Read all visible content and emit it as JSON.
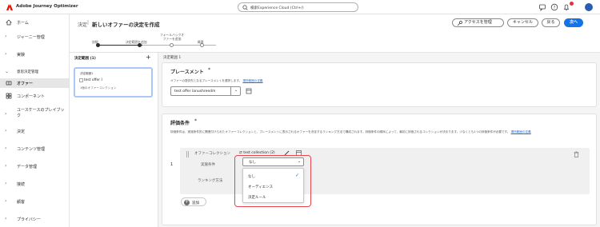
{
  "app": {
    "title": "Adobe Journey Optimizer"
  },
  "search": {
    "placeholder": "検索Experience Cloud (Ctrl+/)"
  },
  "sidebar": {
    "items": [
      {
        "label": "ホーム",
        "icon": "home-icon"
      },
      {
        "label": "ジャーニー管理"
      },
      {
        "label": "実験"
      },
      {
        "heading": "意思決定管理"
      },
      {
        "label": "オファー",
        "icon": "offer-icon",
        "active": true
      },
      {
        "label": "コンポーネント",
        "icon": "components-icon"
      },
      {
        "label": "ユースケースのプレイブック"
      },
      {
        "label": "決定"
      },
      {
        "label": "コンテンツ管理"
      },
      {
        "label": "データ管理"
      },
      {
        "label": "接続"
      },
      {
        "label": "顧客"
      },
      {
        "label": "プライバシー"
      }
    ]
  },
  "header": {
    "breadcrumb": "決定",
    "title": "新しいオファーの決定を作成",
    "manage_access": "アクセスを管理",
    "cancel": "キャンセル",
    "back": "戻る",
    "next": "次へ",
    "steps": [
      "詳細",
      "決定範囲を追加",
      "フォールバックオファーを追加",
      "概要"
    ]
  },
  "left_panel": {
    "title": "決定範囲 (1)",
    "card": {
      "label": "決定範囲1",
      "offer": "test offer I",
      "sub": "1個のオファーコレクション"
    }
  },
  "main": {
    "label": "決定範囲 1",
    "placement": {
      "title": "プレースメント",
      "description": "オファーの提供先となるプレースメントを選択します。",
      "link": "場所範囲の定義",
      "selected": "test offer lanushreedm"
    },
    "eligibility": {
      "title": "評価条件",
      "description": "評価条件は、実施条件的に関連付けられたオファーコレクションと、プレースメントに表示されるオファーを決定するランキング方法で構成されます。評価条件の順序によって、最初に評価されるコレクションが決まります。少なくとも1つの評価条件が必要です。",
      "link": "場所範囲の定義",
      "row_number": "1",
      "collection_label": "オファーコレクション",
      "collection_value": "test collection (2)",
      "constraint_label": "実施条件",
      "constraint_value": "なし",
      "ranking_label": "ランキング方法",
      "options": [
        "なし",
        "オーディエンス",
        "決定ルール"
      ],
      "add_label": "追加"
    }
  },
  "colors": {
    "accent": "#1473e6",
    "highlight": "#e34850"
  }
}
